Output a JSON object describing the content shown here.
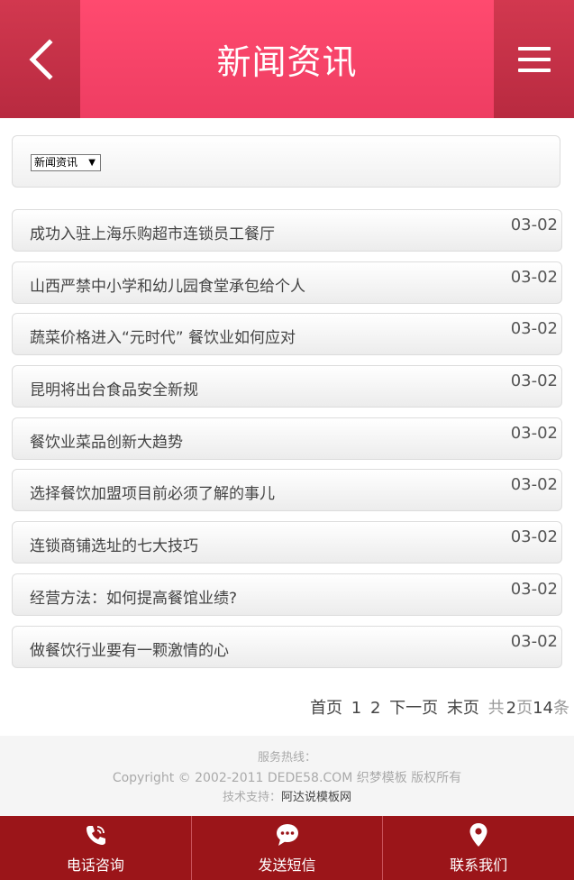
{
  "header": {
    "title": "新闻资讯"
  },
  "filter": {
    "selected": "新闻资讯"
  },
  "news": [
    {
      "title": "成功入驻上海乐购超市连锁员工餐厅",
      "date": "03-02"
    },
    {
      "title": "山西严禁中小学和幼儿园食堂承包给个人",
      "date": "03-02"
    },
    {
      "title": "蔬菜价格进入“元时代” 餐饮业如何应对",
      "date": "03-02"
    },
    {
      "title": "昆明将出台食品安全新规",
      "date": "03-02"
    },
    {
      "title": "餐饮业菜品创新大趋势",
      "date": "03-02"
    },
    {
      "title": "选择餐饮加盟项目前必须了解的事儿",
      "date": "03-02"
    },
    {
      "title": "连锁商铺选址的七大技巧",
      "date": "03-02"
    },
    {
      "title": "经营方法：如何提高餐馆业绩?",
      "date": "03-02"
    },
    {
      "title": "做餐饮行业要有一颗激情的心",
      "date": "03-02"
    }
  ],
  "pager": {
    "first": "首页",
    "page1": "1",
    "page2": "2",
    "next": "下一页",
    "last": "末页",
    "total_prefix": "共",
    "total_pages": "2",
    "pages_unit": "页",
    "total_items": "14",
    "items_unit": "条"
  },
  "footer": {
    "hotline": "服务热线：",
    "copyright": "Copyright © 2002-2011 DEDE58.COM 织梦模板 版权所有",
    "support_label": "技术支持：",
    "support_link": "阿达说模板网"
  },
  "bottom_bar": {
    "phone": "电话咨询",
    "sms": "发送短信",
    "contact": "联系我们"
  },
  "colors": {
    "header": "#ee3d62",
    "bottom_bar": "#9b1519"
  }
}
